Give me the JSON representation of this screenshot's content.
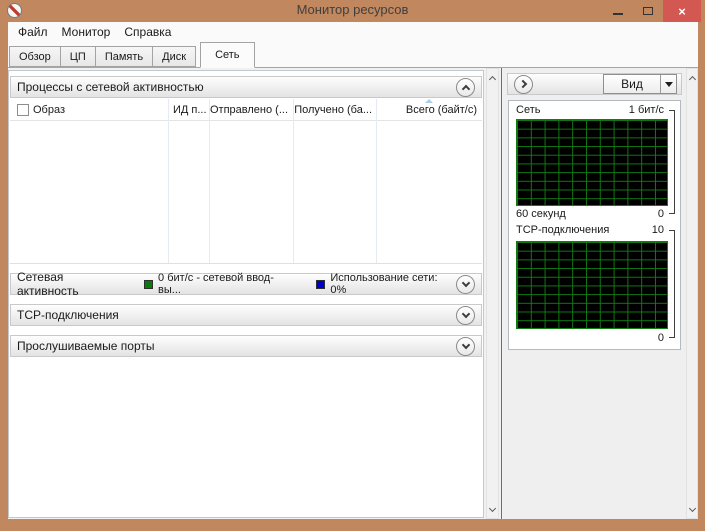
{
  "window": {
    "title": "Монитор ресурсов",
    "app_icon": "resource-monitor-icon",
    "controls": {
      "minimize": "minimize-icon",
      "maximize": "maximize-icon",
      "close_glyph": "×"
    }
  },
  "colors": {
    "frame": "#c1875e",
    "close_button": "#d35852",
    "legend_green": "#0a7a0a",
    "legend_blue": "#0000cc",
    "graph_background": "#000000",
    "graph_grid_green": "#127e12"
  },
  "menu": {
    "items": [
      {
        "label": "Файл"
      },
      {
        "label": "Монитор"
      },
      {
        "label": "Справка"
      }
    ]
  },
  "tabs": [
    {
      "label": "Обзор",
      "active": false
    },
    {
      "label": "ЦП",
      "active": false
    },
    {
      "label": "Память",
      "active": false
    },
    {
      "label": "Диск",
      "active": false
    },
    {
      "label": "Сеть",
      "active": true
    }
  ],
  "processes_section": {
    "title": "Процессы с сетевой активностью",
    "columns": [
      {
        "label": "Образ"
      },
      {
        "label": "ИД п..."
      },
      {
        "label": "Отправлено (..."
      },
      {
        "label": "Получено (ба..."
      },
      {
        "label": "Всего (байт/с)"
      }
    ],
    "rows": []
  },
  "network_activity_section": {
    "title": "Сетевая активность",
    "legend": [
      {
        "color": "#0a7a0a",
        "label": "0 бит/с - сетевой ввод-вы..."
      },
      {
        "color": "#0000cc",
        "label": "Использование сети: 0%"
      }
    ]
  },
  "tcp_section": {
    "title": "TCP-подключения"
  },
  "ports_section": {
    "title": "Прослушиваемые порты"
  },
  "right_panel": {
    "view_button_label": "Вид",
    "charts": [
      {
        "title": "Сеть",
        "max_label": "1 бит/с",
        "x_label": "60 секунд",
        "min_label": "0"
      },
      {
        "title": "TCP-подключения",
        "max_label": "10",
        "x_label": "",
        "min_label": "0"
      }
    ]
  },
  "chart_data": [
    {
      "type": "line",
      "title": "Сеть",
      "ylabel_top": "1 бит/с",
      "ylabel_bottom": "0",
      "xlabel": "60 секунд",
      "ylim": [
        0,
        1
      ],
      "grid": true,
      "series": []
    },
    {
      "type": "line",
      "title": "TCP-подключения",
      "ylabel_top": "10",
      "ylabel_bottom": "0",
      "ylim": [
        0,
        10
      ],
      "grid": true,
      "series": []
    }
  ]
}
